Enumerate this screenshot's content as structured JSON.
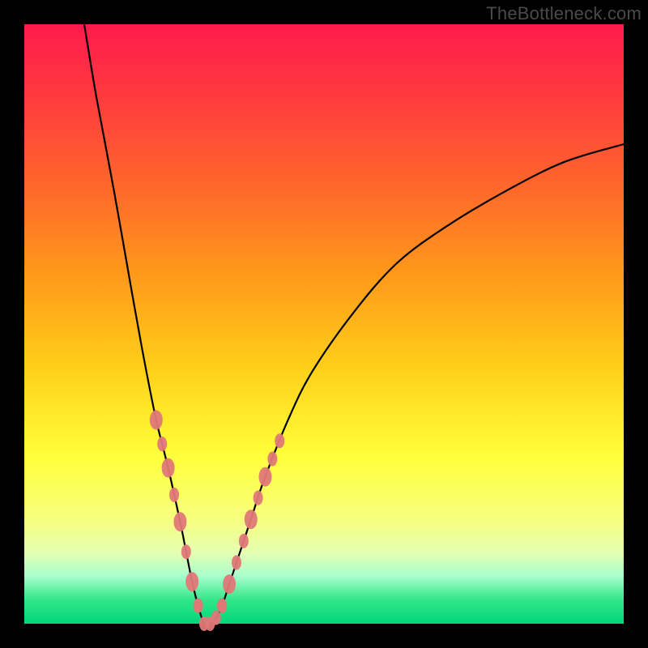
{
  "watermark": "TheBottleneck.com",
  "colors": {
    "background": "#000000",
    "gradient_top": "#ff1a4d",
    "gradient_mid": "#ffd21a",
    "gradient_bottom": "#00d67a",
    "curve": "#000000",
    "marker": "#e07878"
  },
  "chart_data": {
    "type": "line",
    "title": "",
    "xlabel": "",
    "ylabel": "",
    "xlim": [
      0,
      100
    ],
    "ylim": [
      0,
      100
    ],
    "series": [
      {
        "name": "bottleneck-curve",
        "x": [
          10,
          12,
          15,
          18,
          20,
          22,
          24,
          26,
          27,
          28,
          29,
          30,
          31,
          32,
          33,
          34,
          36,
          38,
          40,
          44,
          48,
          55,
          62,
          70,
          80,
          90,
          100
        ],
        "y": [
          100,
          88,
          72,
          55,
          44,
          34,
          26,
          17,
          12,
          7,
          3,
          0,
          0,
          1,
          3,
          6,
          12,
          18,
          24,
          34,
          42,
          52,
          60,
          66,
          72,
          77,
          80
        ]
      }
    ],
    "annotations": {
      "description": "Reddish dotted marker segments highlighting the steep walls of the V near the bottom.",
      "markers_left_x_range": [
        22,
        29
      ],
      "markers_right_x_range": [
        33,
        43
      ],
      "marker_y_range": [
        0,
        40
      ]
    }
  }
}
